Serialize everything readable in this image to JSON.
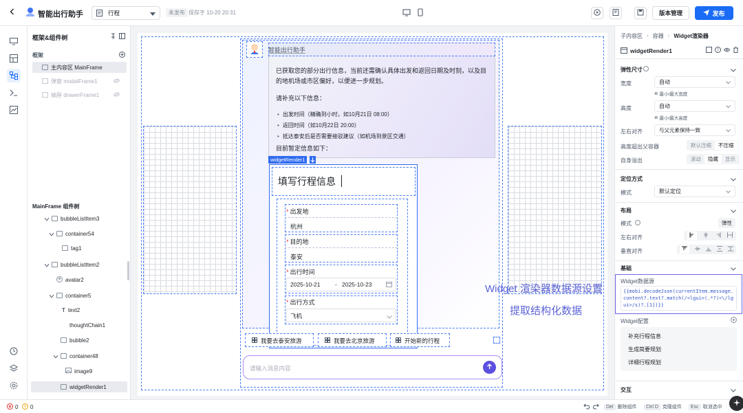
{
  "topbar": {
    "app_title": "智能出行助手",
    "page_select": "行程",
    "status_badge": "未发布",
    "save_time": "保存于 10-20 20:31",
    "version_label": "版本管理",
    "publish_label": "发布"
  },
  "left_panel": {
    "title": "框架&组件树",
    "frame_section": "框架",
    "frames": [
      {
        "label": "主内容区 MainFrame",
        "selected": true
      },
      {
        "label": "弹窗 modalFrame1",
        "selected": false
      },
      {
        "label": "抽屉 drawerFrame1",
        "selected": false
      }
    ],
    "tree_title": "MainFrame 组件树",
    "tree": [
      {
        "label": "bubbleListItem3"
      },
      {
        "label": "container54"
      },
      {
        "label": "tag1"
      },
      {
        "label": "bubbleListItem2"
      },
      {
        "label": "avatar2"
      },
      {
        "label": "container5"
      },
      {
        "label": "text2"
      },
      {
        "label": "thoughtChain1"
      },
      {
        "label": "bubble2"
      },
      {
        "label": "container48"
      },
      {
        "label": "image9"
      },
      {
        "label": "widgetRender1"
      }
    ]
  },
  "canvas": {
    "bot_name": "智能出行助手",
    "message_p1": "已获取您的部分出行信息，当前还需确认具体出发和返回日期及时刻，以及目的地机场或市区偏好，以便进一步规划。",
    "message_p2": "请补充以下信息：",
    "bullets": [
      "出发时间（精确到小时，如10月21日 08:00）",
      "返回时间（如10月22日 20:00）",
      "抵达泰安后是否需要接驳建议（如机场到景区交通）"
    ],
    "message_p3": "目前暂定信息如下：",
    "widget_tag": "widgetRender1",
    "form_title": "填写行程信息",
    "fields": [
      {
        "label": "出发地",
        "value": "杭州"
      },
      {
        "label": "目的地",
        "value": "泰安"
      }
    ],
    "time_label": "出行时间",
    "date_start": "2025-10-21",
    "date_sep": "-",
    "date_end": "2025-10-23",
    "mode_label": "出行方式",
    "mode_value": "飞机",
    "suggestions": [
      "我要去泰安旅游",
      "我要去北京旅游",
      "开始新的行程"
    ],
    "input_placeholder": "请输入消息内容",
    "annotation_line1": "Widget 渲染器数据源设置",
    "annotation_line2": "提取结构化数据"
  },
  "right_panel": {
    "breadcrumb": [
      "子内容区",
      "容器",
      "Widget渲染器"
    ],
    "component_name": "widgetRender1",
    "sections": {
      "flex_size": "弹性尺寸",
      "position": "定位方式",
      "layout": "布局",
      "basic": "基础",
      "interaction": "交互"
    },
    "width_label": "宽度",
    "width_value": "自动",
    "min_max_width": "最小/最大宽度",
    "height_label": "高度",
    "height_value": "自动",
    "min_max_height": "最小/最大高度",
    "align_label": "左右对齐",
    "align_value": "与父元素保持一致",
    "overflow_parent_label": "高度超出父容器",
    "overflow_parent_opts": [
      "默认压缩",
      "不压缩"
    ],
    "self_overflow_label": "自身溢出",
    "self_overflow_opts": [
      "滚动",
      "隐藏",
      "显示"
    ],
    "mode_label": "模式",
    "mode_value": "默认定位",
    "layout_mode_label": "模式",
    "layout_mode_value": "弹性",
    "h_align_label": "左右对齐",
    "v_align_label": "垂直对齐",
    "datasource_label": "Widget数据源",
    "datasource_code": "{{mobi.decodeJson(currentItem.message.content?.text?.match(/<lgui>(.*?)<\\/lgui>/s)?.[1])}}",
    "config_label": "Widget配置",
    "config_items": [
      "补充行程信息",
      "生成简要规划",
      "详细行程规划"
    ]
  },
  "statusbar": {
    "errors": "0",
    "warnings": "0",
    "delete_key": "Del",
    "delete_label": "删除组件",
    "clone_key": "Ctrl D",
    "clone_label": "克隆组件",
    "cancel_key": "Esc",
    "cancel_label": "取消选中"
  },
  "colors": {
    "primary": "#1a6cf6",
    "annotation": "#5b63d6",
    "selection": "#4a7cf7"
  }
}
